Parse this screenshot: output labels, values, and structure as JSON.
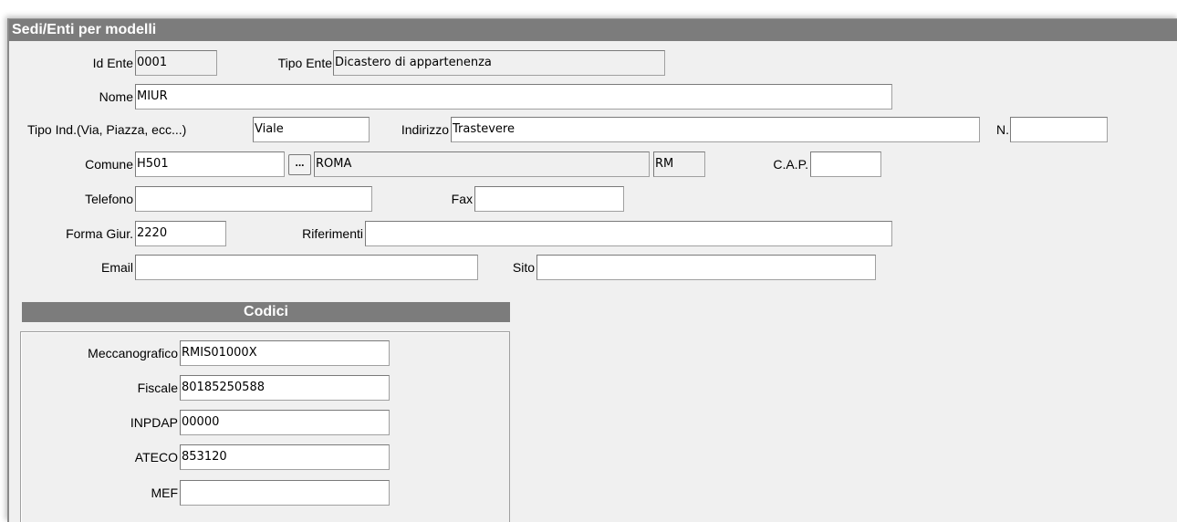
{
  "window": {
    "title": "Sedi/Enti per modelli"
  },
  "form": {
    "id_ente": {
      "label": "Id Ente",
      "value": "0001"
    },
    "tipo_ente": {
      "label": "Tipo Ente",
      "value": "Dicastero di appartenenza"
    },
    "nome": {
      "label": "Nome",
      "value": "MIUR"
    },
    "tipo_ind": {
      "label": "Tipo Ind.(Via, Piazza, ecc...)",
      "value": "Viale"
    },
    "indirizzo": {
      "label": "Indirizzo",
      "value": "Trastevere"
    },
    "numero": {
      "label": "N.",
      "value": ""
    },
    "comune": {
      "label": "Comune",
      "code": "H501",
      "name": "ROMA",
      "province": "RM",
      "lookup_label": "..."
    },
    "cap": {
      "label": "C.A.P.",
      "value": ""
    },
    "telefono": {
      "label": "Telefono",
      "value": ""
    },
    "fax": {
      "label": "Fax",
      "value": ""
    },
    "forma_giur": {
      "label": "Forma Giur.",
      "value": "2220"
    },
    "riferimenti": {
      "label": "Riferimenti",
      "value": ""
    },
    "email": {
      "label": "Email",
      "value": ""
    },
    "sito": {
      "label": "Sito",
      "value": ""
    }
  },
  "codici": {
    "title": "Codici",
    "meccanografico": {
      "label": "Meccanografico",
      "value": "RMIS01000X"
    },
    "fiscale": {
      "label": "Fiscale",
      "value": "80185250588"
    },
    "inpdap": {
      "label": "INPDAP",
      "value": "00000"
    },
    "ateco": {
      "label": "ATECO",
      "value": "853120"
    },
    "mef": {
      "label": "MEF",
      "value": ""
    }
  }
}
